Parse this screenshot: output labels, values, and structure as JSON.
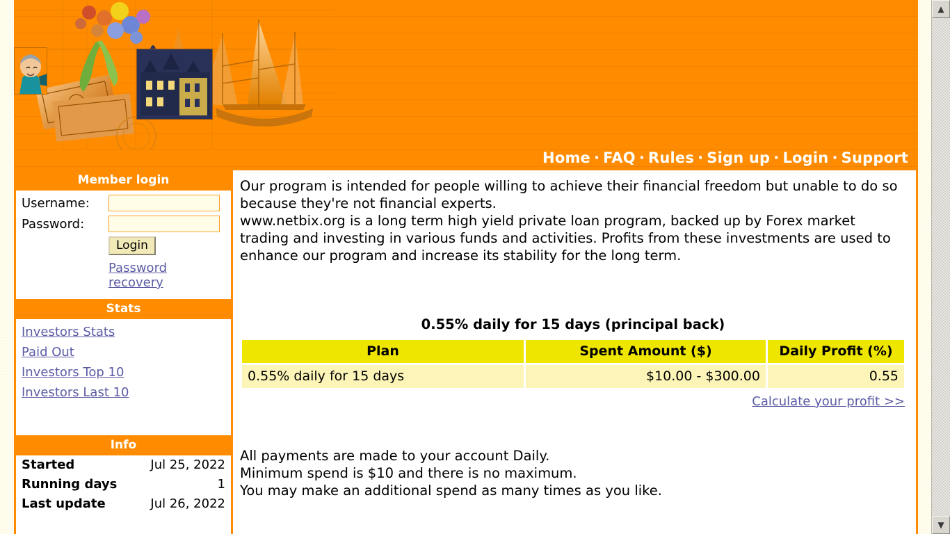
{
  "nav": {
    "items": [
      {
        "label": "Home"
      },
      {
        "label": "FAQ"
      },
      {
        "label": "Rules"
      },
      {
        "label": "Sign up"
      },
      {
        "label": "Login"
      },
      {
        "label": "Support"
      }
    ],
    "separator": "·"
  },
  "sidebar": {
    "login_panel": {
      "title": "Member login",
      "username_label": "Username:",
      "username_value": "",
      "password_label": "Password:",
      "password_value": "",
      "login_button": "Login",
      "recovery_link": "Password recovery"
    },
    "stats_panel": {
      "title": "Stats",
      "links": [
        {
          "label": "Investors Stats"
        },
        {
          "label": "Paid Out"
        },
        {
          "label": "Investors Top 10"
        },
        {
          "label": "Investors Last 10"
        }
      ]
    },
    "info_panel": {
      "title": "Info",
      "rows": [
        {
          "label": "Started",
          "value": "Jul 25, 2022"
        },
        {
          "label": "Running days",
          "value": "1"
        },
        {
          "label": "Last update",
          "value": "Jul 26, 2022"
        }
      ]
    }
  },
  "main": {
    "intro": "Our program is intended for people willing to achieve their financial freedom but unable to do so because they're not financial experts.\nwww.netbix.org is a long term high yield private loan program, backed up by Forex market trading and investing in various funds and activities. Profits from these investments are used to enhance our program and increase its stability for the long term.",
    "plan_heading": "0.55% daily for 15 days (principal back)",
    "table": {
      "headers": [
        "Plan",
        "Spent Amount ($)",
        "Daily Profit (%)"
      ],
      "rows": [
        {
          "plan": "0.55% daily for 15 days",
          "amount": "$10.00 - $300.00",
          "profit": "0.55"
        }
      ]
    },
    "calculate_link": "Calculate your profit >>",
    "terms": "All payments are made to your account Daily.\nMinimum spend is $10 and there is no maximum.\nYou may make an additional spend as many times as you like."
  },
  "scrollbar": {
    "up_arrow": "▲",
    "down_arrow": "▼"
  },
  "colors": {
    "brand_orange": "#ff8c00",
    "table_header_yellow": "#efe600",
    "table_row_yellow": "#fdf5b8",
    "link_purple": "#5b5ba5"
  }
}
